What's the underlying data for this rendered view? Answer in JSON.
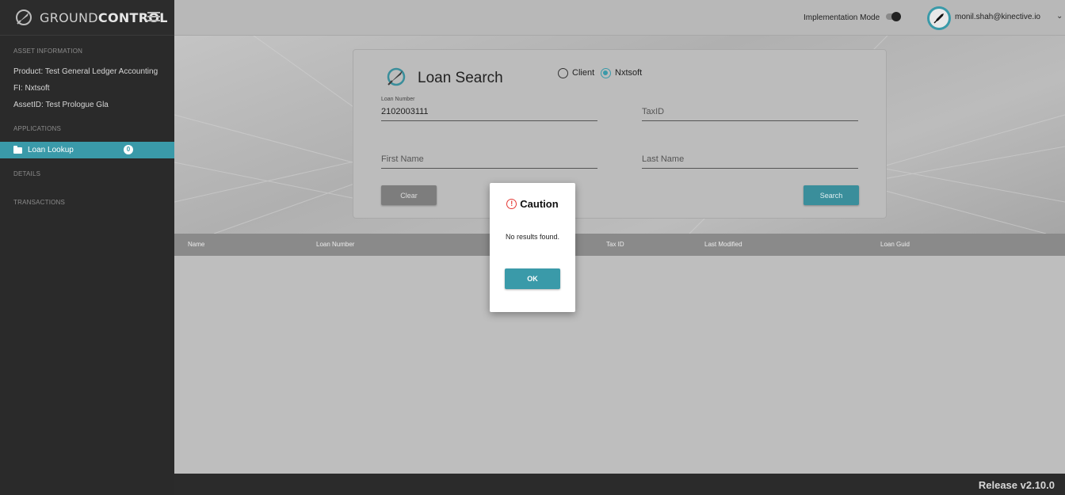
{
  "brand": {
    "name_light": "GROUND",
    "name_bold": "CONTROL",
    "logo_icon": "rocket-swirl-icon"
  },
  "sidebar": {
    "asset_heading": "ASSET INFORMATION",
    "product": "Product:  Test General Ledger Accounting",
    "fi": "FI:  Nxtsoft",
    "asset_id": "AssetID:  Test Prologue Gla",
    "apps_heading": "APPLICATIONS",
    "active_item": {
      "label": "Loan Lookup",
      "badge": "0",
      "icon": "folder-icon"
    },
    "details_heading": "DETAILS",
    "transactions_heading": "TRANSACTIONS"
  },
  "header": {
    "impl_mode_label": "Implementation Mode",
    "impl_mode_on": false,
    "user_email": "monil.shah@kinective.io",
    "chevron": "⌄"
  },
  "search": {
    "title": "Loan Search",
    "radio_client": "Client",
    "radio_nxtsoft": "Nxtsoft",
    "selected_source": "Nxtsoft",
    "loan_number_label": "Loan Number",
    "loan_number_value": "2102003111",
    "taxid_placeholder": "TaxID",
    "first_name_placeholder": "First Name",
    "last_name_placeholder": "Last Name",
    "clear_label": "Clear",
    "search_label": "Search"
  },
  "table": {
    "columns": [
      "Name",
      "Loan Number",
      "Tax ID",
      "Last Modified",
      "Loan Guid"
    ]
  },
  "footer": {
    "release": "Release v2.10.0"
  },
  "modal": {
    "title": "Caution",
    "message": "No results found.",
    "ok_label": "OK",
    "warn_icon": "!"
  },
  "colors": {
    "accent": "#3a9aa9",
    "sidebar_bg": "#2a2a2a",
    "warning": "#e53935"
  }
}
